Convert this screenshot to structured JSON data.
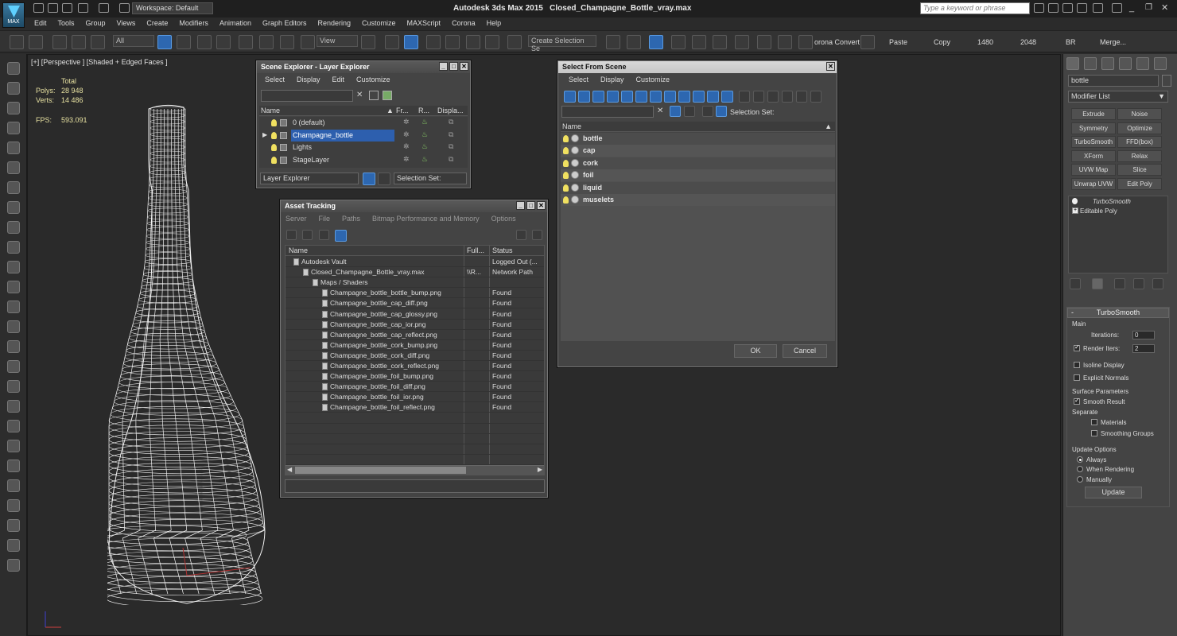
{
  "app": {
    "title": "Autodesk 3ds Max 2015",
    "file": "Closed_Champagne_Bottle_vray.max",
    "logo_text": "MAX",
    "workspace": "Workspace: Default",
    "search_placeholder": "Type a keyword or phrase"
  },
  "menu": [
    "Edit",
    "Tools",
    "Group",
    "Views",
    "Create",
    "Modifiers",
    "Animation",
    "Graph Editors",
    "Rendering",
    "Customize",
    "MAXScript",
    "Corona",
    "Help"
  ],
  "toolbar": {
    "filter": "All",
    "view": "View",
    "selection_set": "Create Selection Se",
    "corona_convert": "orona Convert",
    "paste": "Paste",
    "copy": "Copy",
    "w1480": "1480",
    "w2048": "2048",
    "br": "BR",
    "merge": "Merge..."
  },
  "viewport": {
    "label": "[+] [Perspective ] [Shaded + Edged Faces ]",
    "total": "Total",
    "polys_label": "Polys:",
    "polys": "28 948",
    "verts_label": "Verts:",
    "verts": "14 486",
    "fps_label": "FPS:",
    "fps": "593.091"
  },
  "scene_explorer": {
    "title": "Scene Explorer - Layer Explorer",
    "menu": [
      "Select",
      "Display",
      "Edit",
      "Customize"
    ],
    "col_name": "Name",
    "col_fr": "Fr...",
    "col_r": "R...",
    "col_disp": "Displa...",
    "layers": [
      "0 (default)",
      "Champagne_bottle",
      "Lights",
      "StageLayer"
    ],
    "selected_index": 1,
    "footer_mode": "Layer Explorer",
    "selection_set_label": "Selection Set:"
  },
  "asset_tracking": {
    "title": "Asset Tracking",
    "menu": [
      "Server",
      "File",
      "Paths",
      "Bitmap Performance and Memory",
      "Options"
    ],
    "col_name": "Name",
    "col_full": "Full...",
    "col_status": "Status",
    "rows": [
      {
        "name": "Autodesk Vault",
        "full": "",
        "status": "Logged Out (...",
        "indent": 0
      },
      {
        "name": "Closed_Champagne_Bottle_vray.max",
        "full": "\\\\R...",
        "status": "Network Path",
        "indent": 1
      },
      {
        "name": "Maps / Shaders",
        "full": "",
        "status": "",
        "indent": 2
      },
      {
        "name": "Champagne_bottle_bottle_bump.png",
        "full": "",
        "status": "Found",
        "indent": 3
      },
      {
        "name": "Champagne_bottle_cap_diff.png",
        "full": "",
        "status": "Found",
        "indent": 3
      },
      {
        "name": "Champagne_bottle_cap_glossy.png",
        "full": "",
        "status": "Found",
        "indent": 3
      },
      {
        "name": "Champagne_bottle_cap_ior.png",
        "full": "",
        "status": "Found",
        "indent": 3
      },
      {
        "name": "Champagne_bottle_cap_reflect.png",
        "full": "",
        "status": "Found",
        "indent": 3
      },
      {
        "name": "Champagne_bottle_cork_bump.png",
        "full": "",
        "status": "Found",
        "indent": 3
      },
      {
        "name": "Champagne_bottle_cork_diff.png",
        "full": "",
        "status": "Found",
        "indent": 3
      },
      {
        "name": "Champagne_bottle_cork_reflect.png",
        "full": "",
        "status": "Found",
        "indent": 3
      },
      {
        "name": "Champagne_bottle_foil_bump.png",
        "full": "",
        "status": "Found",
        "indent": 3
      },
      {
        "name": "Champagne_bottle_foil_diff.png",
        "full": "",
        "status": "Found",
        "indent": 3
      },
      {
        "name": "Champagne_bottle_foil_ior.png",
        "full": "",
        "status": "Found",
        "indent": 3
      },
      {
        "name": "Champagne_bottle_foil_reflect.png",
        "full": "",
        "status": "Found",
        "indent": 3
      }
    ]
  },
  "select_from_scene": {
    "title": "Select From Scene",
    "menu": [
      "Select",
      "Display",
      "Customize"
    ],
    "selection_set_label": "Selection Set:",
    "col_name": "Name",
    "objects": [
      "bottle",
      "cap",
      "cork",
      "foil",
      "liquid",
      "muselets"
    ],
    "ok": "OK",
    "cancel": "Cancel"
  },
  "command_panel": {
    "object_name": "bottle",
    "modifier_list": "Modifier List",
    "buttons": [
      "Extrude",
      "Noise",
      "Symmetry",
      "Optimize",
      "TurboSmooth",
      "FFD(box)",
      "XForm",
      "Relax",
      "UVW Map",
      "Slice",
      "Unwrap UVW",
      "Edit Poly"
    ],
    "stack": [
      "TurboSmooth",
      "Editable Poly"
    ],
    "rollout_title": "TurboSmooth",
    "main_label": "Main",
    "iterations_label": "Iterations:",
    "iterations": "0",
    "render_iters_label": "Render Iters:",
    "render_iters": "2",
    "isoline": "Isoline Display",
    "explicit_normals": "Explicit Normals",
    "surface_params": "Surface Parameters",
    "smooth_result": "Smooth Result",
    "separate": "Separate",
    "materials": "Materials",
    "smoothing_groups": "Smoothing Groups",
    "update_options": "Update Options",
    "always": "Always",
    "when_rendering": "When Rendering",
    "manually": "Manually",
    "update": "Update"
  }
}
